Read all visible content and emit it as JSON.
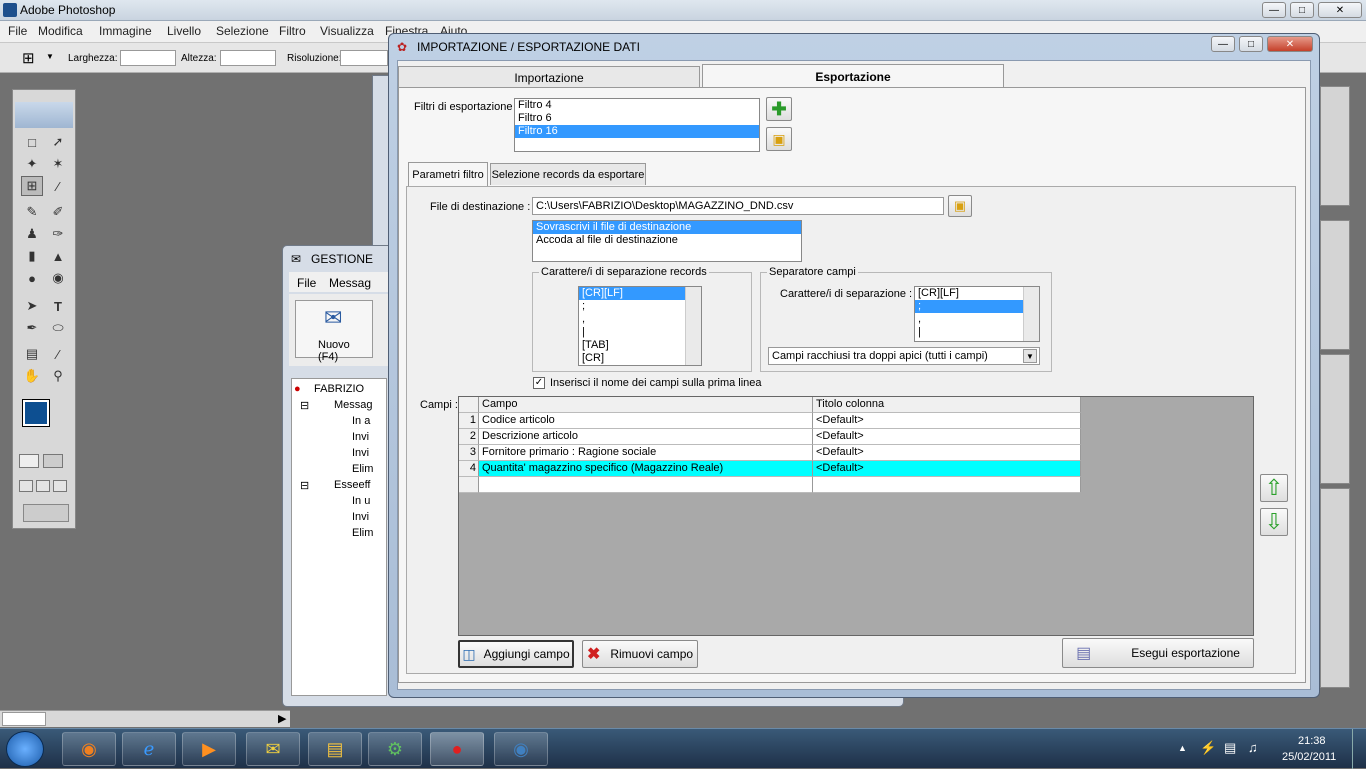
{
  "photoshop": {
    "title": "Adobe Photoshop",
    "menu": [
      "File",
      "Modifica",
      "Immagine",
      "Livello",
      "Selezione",
      "Filtro",
      "Visualizza",
      "Finestra",
      "Aiuto"
    ],
    "options": {
      "width_label": "Larghezza:",
      "height_label": "Altezza:",
      "resolution_label": "Risoluzione:"
    }
  },
  "gestione": {
    "title": "GESTIONE",
    "menu": [
      "File",
      "Messag"
    ],
    "new_button": "Nuovo (F4)",
    "tree": {
      "root": "FABRIZIO",
      "group1": "Messag",
      "items1": [
        "In a",
        "Invi",
        "Invi",
        "Elim"
      ],
      "group2": "Esseeff",
      "items2": [
        "In u",
        "Invi",
        "Elim"
      ]
    }
  },
  "dialog": {
    "title": "IMPORTAZIONE / ESPORTAZIONE DATI",
    "tabs": [
      "Importazione",
      "Esportazione"
    ],
    "filters_label": "Filtri di esportazione :",
    "filters": [
      "Filtro 4",
      "Filtro 6",
      "Filtro 16"
    ],
    "subtabs": [
      "Parametri filtro",
      "Selezione records da esportare"
    ],
    "dest_label": "File di destinazione :",
    "dest_value": "C:\\Users\\FABRIZIO\\Desktop\\MAGAZZINO_DND.csv",
    "dest_modes": [
      "Sovrascrivi il file di destinazione",
      "Accoda al file di destinazione"
    ],
    "rec_sep_group": "Carattere/i di separazione records",
    "rec_sep_items": [
      "[CR][LF]",
      ";",
      ",",
      "|",
      "[TAB]",
      "[CR]"
    ],
    "field_sep_group": "Separatore campi",
    "field_sep_label": "Carattere/i di separazione :",
    "field_sep_items": [
      "[CR][LF]",
      ";",
      ",",
      "|"
    ],
    "quote_select": "Campi racchiusi tra doppi apici (tutti i campi)",
    "header_checkbox": "Inserisci il nome dei campi sulla prima linea",
    "fields_label": "Campi :",
    "grid": {
      "headers": [
        "Campo",
        "Titolo colonna"
      ],
      "rows": [
        {
          "n": "1",
          "campo": "Codice articolo",
          "titolo": "<Default>"
        },
        {
          "n": "2",
          "campo": "Descrizione articolo",
          "titolo": "<Default>"
        },
        {
          "n": "3",
          "campo": "Fornitore primario : Ragione sociale",
          "titolo": "<Default>"
        },
        {
          "n": "4",
          "campo": "Quantita' magazzino specifico (Magazzino Reale)",
          "titolo": "<Default>"
        }
      ]
    },
    "add_field": "Aggiungi campo",
    "remove_field": "Rimuovi campo",
    "run_export": "Esegui esportazione"
  },
  "taskbar": {
    "time": "21:38",
    "date": "25/02/2011"
  }
}
